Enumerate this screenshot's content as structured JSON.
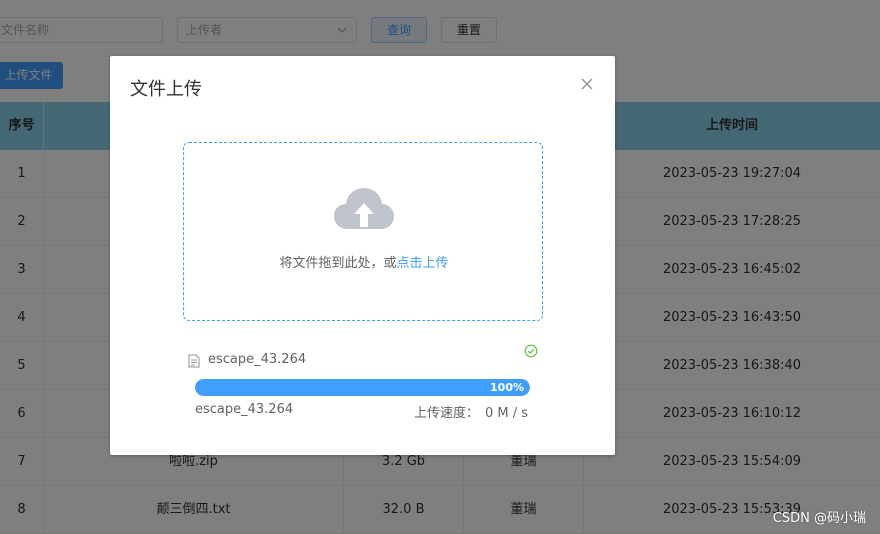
{
  "filters": {
    "filename_placeholder": "文件名称",
    "uploader_placeholder": "上传者",
    "query_label": "查询",
    "reset_label": "重置",
    "upload_button_label": "上传文件"
  },
  "table": {
    "headers": [
      "序号",
      "",
      "",
      "",
      "上传时间"
    ],
    "rows": [
      {
        "idx": "1",
        "name": "",
        "size": "",
        "user": "",
        "time": "2023-05-23 19:27:04"
      },
      {
        "idx": "2",
        "name": "",
        "size": "",
        "user": "",
        "time": "2023-05-23 17:28:25"
      },
      {
        "idx": "3",
        "name": "",
        "size": "",
        "user": "",
        "time": "2023-05-23 16:45:02"
      },
      {
        "idx": "4",
        "name": "",
        "size": "",
        "user": "",
        "time": "2023-05-23 16:43:50"
      },
      {
        "idx": "5",
        "name": "",
        "size": "",
        "user": "",
        "time": "2023-05-23 16:38:40"
      },
      {
        "idx": "6",
        "name": "",
        "size": "",
        "user": "",
        "time": "2023-05-23 16:10:12"
      },
      {
        "idx": "7",
        "name": "啦啦.zip",
        "size": "3.2 Gb",
        "user": "董瑞",
        "time": "2023-05-23 15:54:09"
      },
      {
        "idx": "8",
        "name": "颠三倒四.txt",
        "size": "32.0 B",
        "user": "董瑞",
        "time": "2023-05-23 15:53:39"
      }
    ]
  },
  "dialog": {
    "title": "文件上传",
    "drop_text": "将文件拖到此处，或",
    "drop_link": "点击上传",
    "file_name": "escape_43.264",
    "progress_percent": 100,
    "progress_label": "100%",
    "meta_name": "escape_43.264",
    "speed_label": "上传速度：",
    "speed_value": "0 M / s"
  },
  "watermark": "CSDN @码小瑞",
  "colors": {
    "primary": "#409eff",
    "header_bg": "#8bd0ea",
    "success": "#67c23a"
  }
}
